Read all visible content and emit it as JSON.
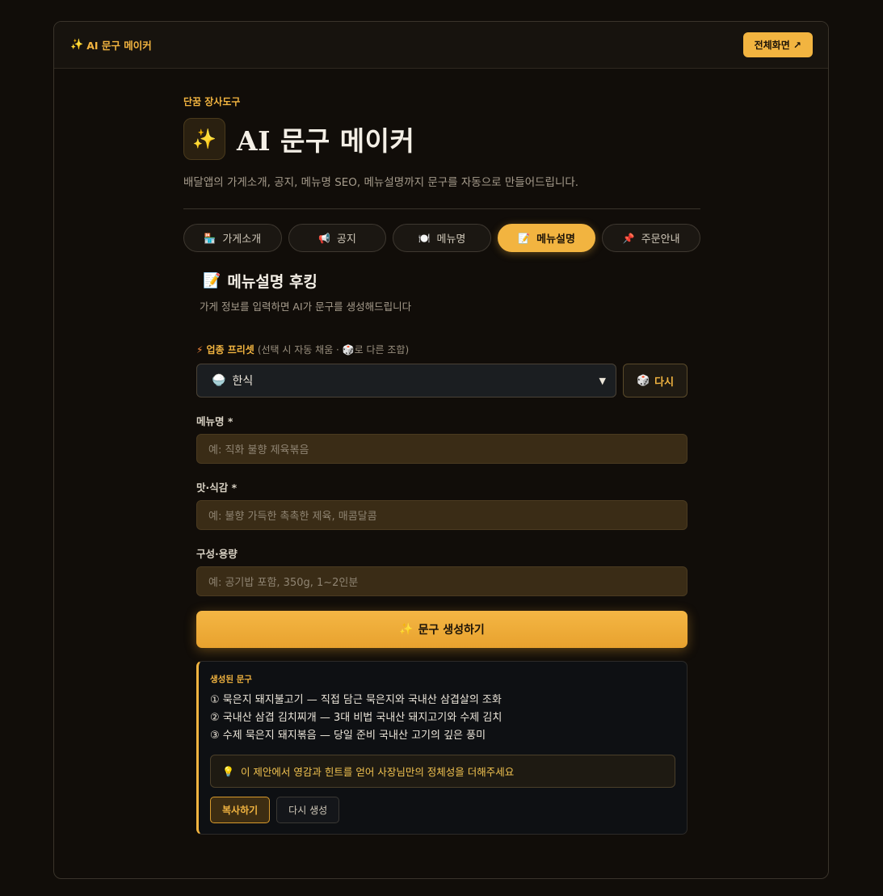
{
  "topbar": {
    "title_icon": "✨",
    "title": "AI 문구 메이커",
    "fullscreen_label": "전체화면 ↗"
  },
  "header": {
    "eyebrow": "단꿈 장사도구",
    "icon": "✨",
    "title": "AI 문구 메이커",
    "subtitle": "배달앱의 가게소개, 공지, 메뉴명 SEO, 메뉴설명까지 문구를 자동으로 만들어드립니다."
  },
  "tabs": [
    {
      "icon": "🏪",
      "label": "가게소개",
      "active": false
    },
    {
      "icon": "📢",
      "label": "공지",
      "active": false
    },
    {
      "icon": "🍽️",
      "label": "메뉴명",
      "active": false
    },
    {
      "icon": "📝",
      "label": "메뉴설명",
      "active": true
    },
    {
      "icon": "📌",
      "label": "주문안내",
      "active": false
    }
  ],
  "panel": {
    "icon": "📝",
    "title": "메뉴설명 후킹",
    "description": "가게 정보를 입력하면 AI가 문구를 생성해드립니다"
  },
  "preset": {
    "icon": "⚡",
    "label": "업종 프리셋",
    "hint_prefix": "(선택 시 자동 채움 · ",
    "hint_icon": "🎲",
    "hint_suffix": "로 다른 조합)",
    "selected_icon": "🍚",
    "selected": "한식",
    "retry_icon": "🎲",
    "retry_label": "다시"
  },
  "fields": [
    {
      "label": "메뉴명 *",
      "placeholder": "예: 직화 불향 제육볶음"
    },
    {
      "label": "맛·식감 *",
      "placeholder": "예: 불향 가득한 촉촉한 제육, 매콤달콤"
    },
    {
      "label": "구성·용량",
      "placeholder": "예: 공기밥 포함, 350g, 1~2인분"
    }
  ],
  "generate": {
    "icon": "✨",
    "label": "문구 생성하기"
  },
  "result": {
    "label": "생성된 문구",
    "lines": [
      "① 묵은지 돼지불고기 — 직접 담근 묵은지와 국내산 삼겹살의 조화",
      "② 국내산 삼겹 김치찌개 — 3대 비법 국내산 돼지고기와 수제 김치",
      "③ 수제 묵은지 돼지볶음 — 당일 준비 국내산 고기의 깊은 풍미"
    ],
    "tip_icon": "💡",
    "tip": "이 제안에서 영감과 힌트를 얻어 사장님만의 정체성을 더해주세요",
    "copy_label": "복사하기",
    "regen_label": "다시 생성"
  },
  "colors": {
    "accent": "#f2b440",
    "background": "#110d09",
    "input_bg": "#3a2c16"
  }
}
